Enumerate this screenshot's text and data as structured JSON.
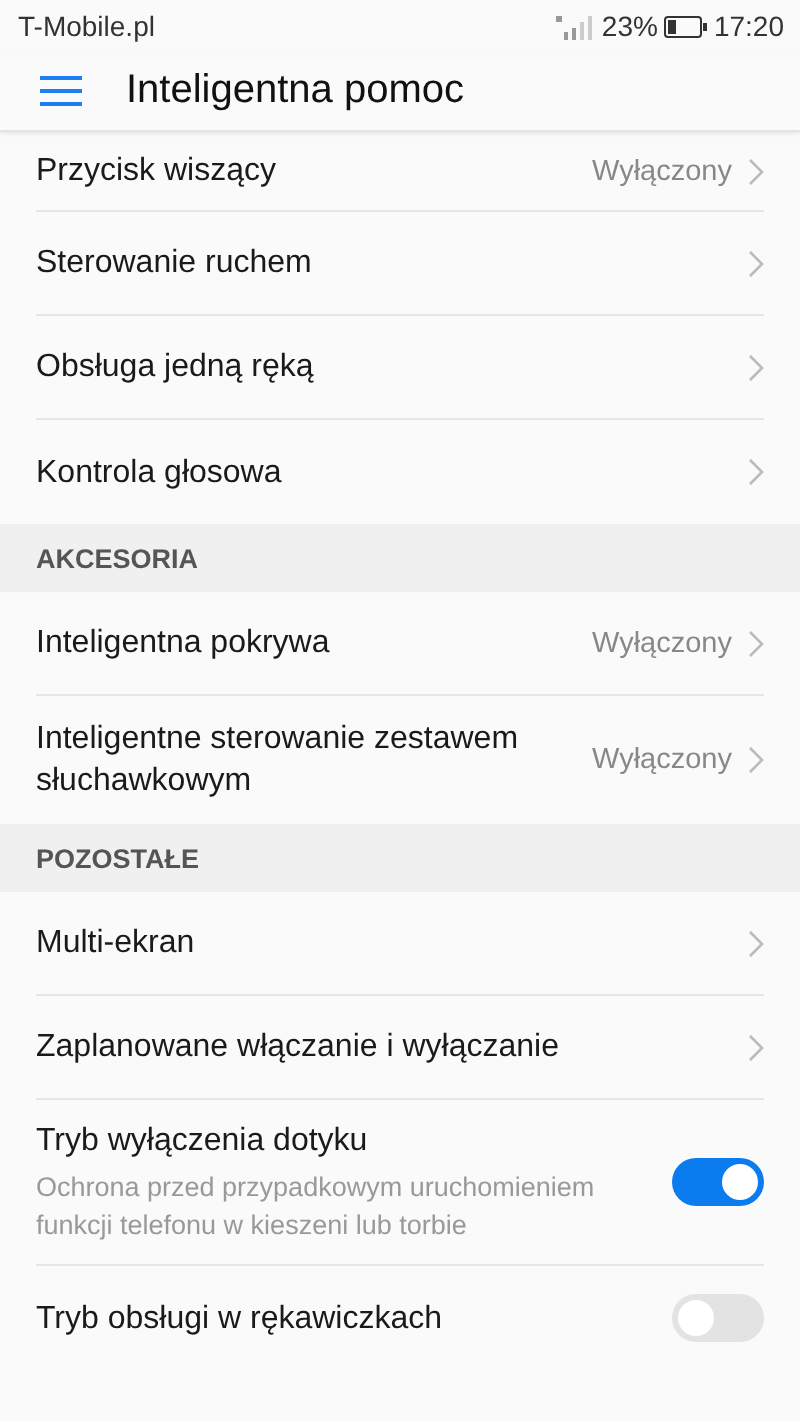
{
  "status_bar": {
    "carrier": "T-Mobile.pl",
    "battery": "23%",
    "time": "17:20"
  },
  "header": {
    "title": "Inteligentna pomoc"
  },
  "sections": [
    {
      "items": [
        {
          "kind": "nav",
          "label": "Przycisk wiszący",
          "value": "Wyłączony"
        },
        {
          "kind": "nav",
          "label": "Sterowanie ruchem"
        },
        {
          "kind": "nav",
          "label": "Obsługa jedną ręką"
        },
        {
          "kind": "nav",
          "label": "Kontrola głosowa"
        }
      ]
    },
    {
      "title": "AKCESORIA",
      "items": [
        {
          "kind": "nav",
          "label": "Inteligentna pokrywa",
          "value": "Wyłączony"
        },
        {
          "kind": "nav",
          "label": "Inteligentne sterowanie zestawem słuchawkowym",
          "value": "Wyłączony"
        }
      ]
    },
    {
      "title": "POZOSTAŁE",
      "items": [
        {
          "kind": "nav",
          "label": "Multi-ekran"
        },
        {
          "kind": "nav",
          "label": "Zaplanowane włączanie i wyłączanie"
        },
        {
          "kind": "toggle",
          "label": "Tryb wyłączenia dotyku",
          "subtitle": "Ochrona przed przypadkowym uruchomieniem funkcji telefonu w kieszeni lub torbie",
          "on": true
        },
        {
          "kind": "toggle",
          "label": "Tryb obsługi w rękawiczkach",
          "on": false
        }
      ]
    }
  ]
}
